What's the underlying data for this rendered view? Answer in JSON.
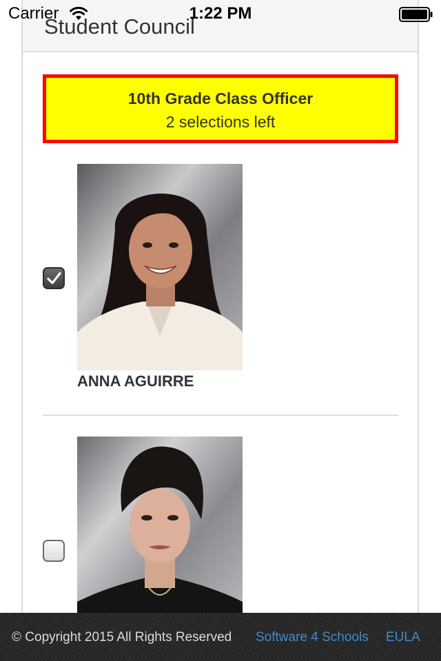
{
  "status_bar": {
    "carrier": "Carrier",
    "time": "1:22 PM",
    "wifi_icon": "wifi-icon",
    "battery_icon": "battery-full-icon"
  },
  "header": {
    "title": "Student Council"
  },
  "banner": {
    "title": "10th Grade Class Officer",
    "subtitle": "2 selections left",
    "background_color": "#ffff00",
    "border_color": "#ff0000"
  },
  "candidates": [
    {
      "name": "ANNA AGUIRRE",
      "checked": true
    },
    {
      "name": "",
      "checked": false
    }
  ],
  "footer": {
    "copyright": "© Copyright 2015 All Rights Reserved",
    "company_link": "Software 4 Schools",
    "eula_link": "EULA",
    "link_color": "#428bca"
  }
}
